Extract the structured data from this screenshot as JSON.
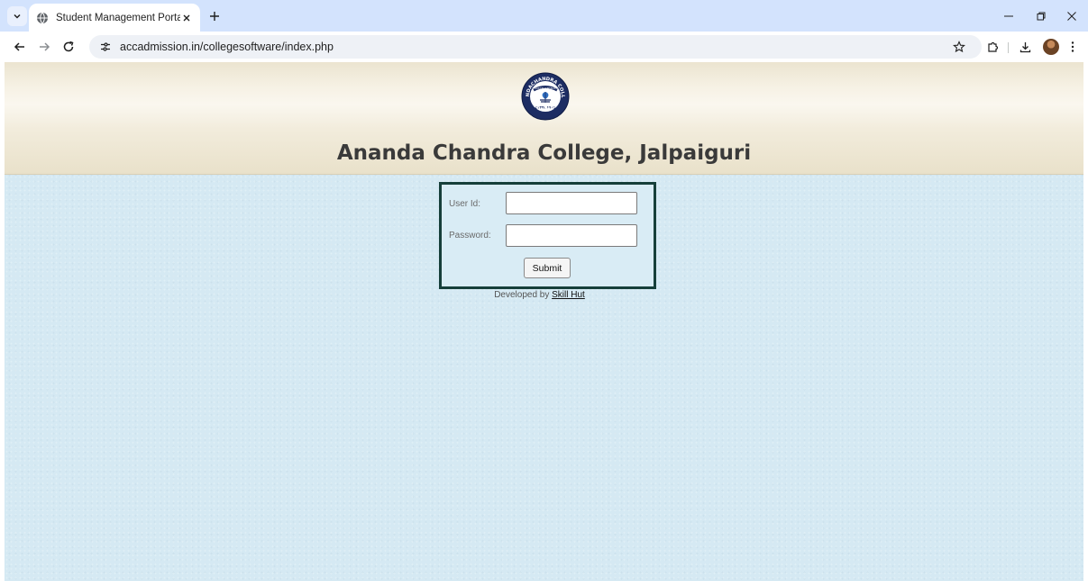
{
  "browser": {
    "tab": {
      "title": "Student Management Portal"
    },
    "omnibox": {
      "url": "accadmission.in/collegesoftware/index.php"
    },
    "icons": {
      "tab_search": "chevron-down-icon",
      "favicon": "globe-icon",
      "tab_close": "close-icon",
      "new_tab": "plus-icon",
      "minimize": "minimize-icon",
      "restore": "restore-icon",
      "close_window": "close-icon",
      "back": "back-arrow-icon",
      "forward": "forward-arrow-icon",
      "reload": "reload-icon",
      "site_info": "tune-icon",
      "bookmark": "star-icon",
      "extensions": "puzzle-icon",
      "downloads": "download-icon",
      "menu": "kebab-menu-icon"
    }
  },
  "page": {
    "logo": {
      "top_text": "ANANDACHANDRA COLLEGE",
      "ribbon_text": "TRUST IN OURSELVES",
      "estd": "ESTD. 1942",
      "bottom_text": "JALPAIGURI"
    },
    "college_name": "Ananda Chandra College, Jalpaiguri",
    "login": {
      "user_id_label": "User Id:",
      "user_id_value": "",
      "password_label": "Password:",
      "password_value": "",
      "submit_label": "Submit"
    },
    "footer": {
      "developed_by": "Developed by",
      "developer_link": "Skill Hut"
    }
  },
  "colors": {
    "tab_strip": "#d3e3fd",
    "page_background": "#d5e9f3",
    "login_border": "#163f3a",
    "header_background": "#f6f1e4"
  }
}
